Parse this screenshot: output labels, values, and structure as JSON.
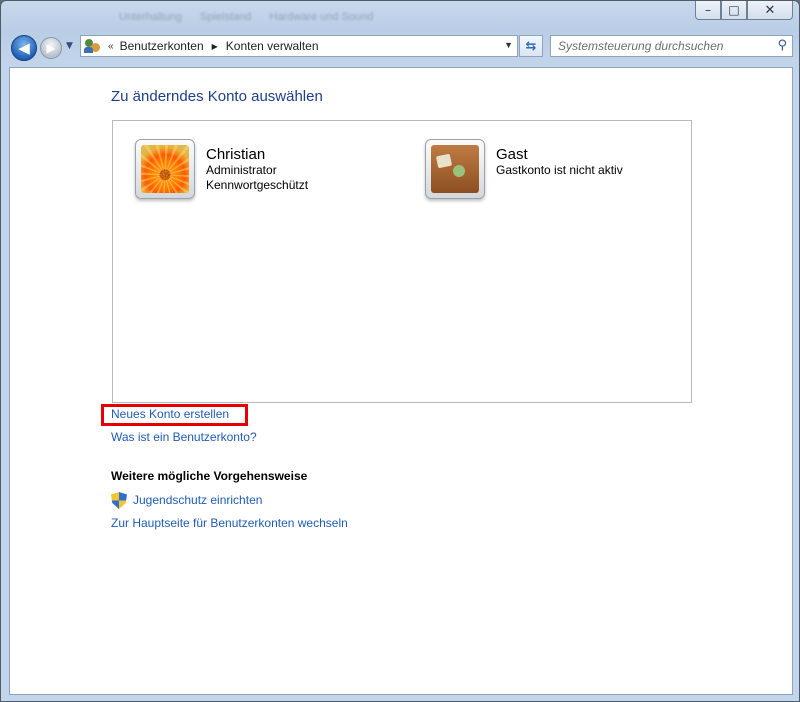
{
  "window": {
    "background_titles": [
      "Unterhaltung",
      "Spielstand",
      "Hardware und Sound"
    ],
    "caption": {
      "minimize": "–",
      "maximize": "□",
      "close": "✕"
    }
  },
  "nav": {
    "back": "◀",
    "forward": "▶",
    "history": "▼",
    "address": {
      "overflow": "«",
      "crumbs": [
        "Benutzerkonten",
        "Konten verwalten"
      ],
      "chevron": "▶",
      "dropdown": "▼"
    },
    "refresh": "⇆",
    "search": {
      "placeholder": "Systemsteuerung durchsuchen",
      "icon": "⚲"
    }
  },
  "main": {
    "title": "Zu änderndes Konto auswählen",
    "accounts": [
      {
        "name": "Christian",
        "lines": [
          "Administrator",
          "Kennwortgeschützt"
        ],
        "picture": "flower"
      },
      {
        "name": "Gast",
        "lines": [
          "Gastkonto ist nicht aktiv"
        ],
        "picture": "suitcase"
      }
    ],
    "links": {
      "create_account": "Neues Konto erstellen",
      "what_is_account": "Was ist ein Benutzerkonto?"
    },
    "other_tasks": {
      "heading": "Weitere mögliche Vorgehensweise",
      "parental_controls": "Jugendschutz einrichten",
      "main_page": "Zur Hauptseite für Benutzerkonten wechseln"
    }
  },
  "colors": {
    "link": "#1f5bb6",
    "title": "#1e3f87",
    "highlight": "#e60000"
  }
}
